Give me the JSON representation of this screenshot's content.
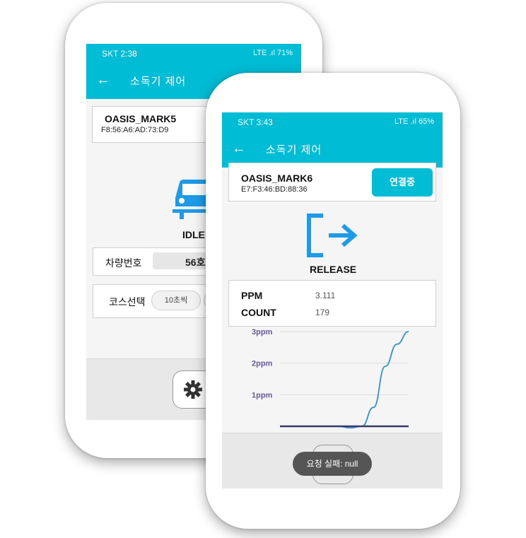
{
  "back_phone": {
    "status": {
      "carrier_time": "SKT 2:38",
      "right_info": "LTE .ıl 71%"
    },
    "appbar": {
      "back": "←",
      "title": "소독기 제어"
    },
    "device": {
      "name": "OASIS_MARK5",
      "mac": "F8:56:A6:AD:73:D9"
    },
    "state": {
      "label": "IDLE",
      "icon": "car-icon"
    },
    "vehicle": {
      "label": "차량번호",
      "value": "56호"
    },
    "course": {
      "label": "코스선택",
      "option_1": "10초씩"
    },
    "settings": {
      "icon": "gear-icon"
    }
  },
  "front_phone": {
    "status": {
      "carrier_time": "SKT 3:43",
      "right_info": "LTE .ıl 65%"
    },
    "appbar": {
      "back": "←",
      "title": "소독기 제어"
    },
    "device": {
      "name": "OASIS_MARK6",
      "mac": "E7:F3:46:BD:88:36",
      "connect_label": "연결중"
    },
    "state": {
      "label": "RELEASE",
      "icon": "release-icon"
    },
    "metrics": {
      "ppm_label": "PPM",
      "ppm_value": "3.111",
      "count_label": "COUNT",
      "count_value": "179"
    },
    "toast": "요청 실패: null"
  },
  "colors": {
    "accent": "#00bcd4",
    "release_icon": "#1e9be8",
    "line_blue": "#2f8fd8",
    "line_dark": "#3a3a6a"
  },
  "chart_data": {
    "type": "line",
    "title": "",
    "xlabel": "",
    "ylabel": "",
    "yticks": [
      "1ppm",
      "2ppm",
      "3ppm"
    ],
    "ylim": [
      0,
      3
    ],
    "series": [
      {
        "values": [
          0,
          0,
          0,
          0,
          0,
          0,
          -0.05,
          0,
          0.6,
          1.9,
          2.6,
          3.0
        ]
      },
      {
        "values": [
          0,
          0,
          0,
          0,
          0,
          0,
          0,
          0,
          0,
          0,
          0,
          0
        ]
      }
    ]
  }
}
